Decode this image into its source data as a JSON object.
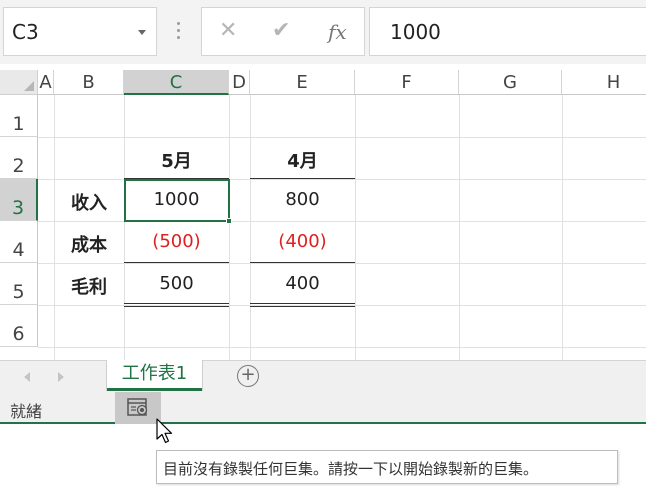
{
  "formula_bar": {
    "name_box": "C3",
    "cancel_icon": "✕",
    "enter_icon": "✔",
    "fx_label": "fx",
    "formula_value": "1000"
  },
  "grid": {
    "columns": [
      "A",
      "B",
      "C",
      "D",
      "E",
      "F",
      "G",
      "H"
    ],
    "rows": [
      "1",
      "2",
      "3",
      "4",
      "5",
      "6"
    ],
    "selected_column": "C",
    "selected_row": "3",
    "cells": {
      "C2": "5月",
      "E2": "4月",
      "B3": "收入",
      "C3": "1000",
      "E3": "800",
      "B4": "成本",
      "C4": "(500)",
      "E4": "(400)",
      "B5": "毛利",
      "C5": "500",
      "E5": "400"
    },
    "negative_color": "#e02020",
    "accent_color": "#217346"
  },
  "sheets": {
    "active_tab": "工作表1",
    "add_sheet_icon": "+"
  },
  "status_bar": {
    "status": "就緒",
    "macro_icon": "macro-record-icon"
  },
  "tooltip": {
    "text": "目前沒有錄製任何巨集。請按一下以開始錄製新的巨集。"
  }
}
